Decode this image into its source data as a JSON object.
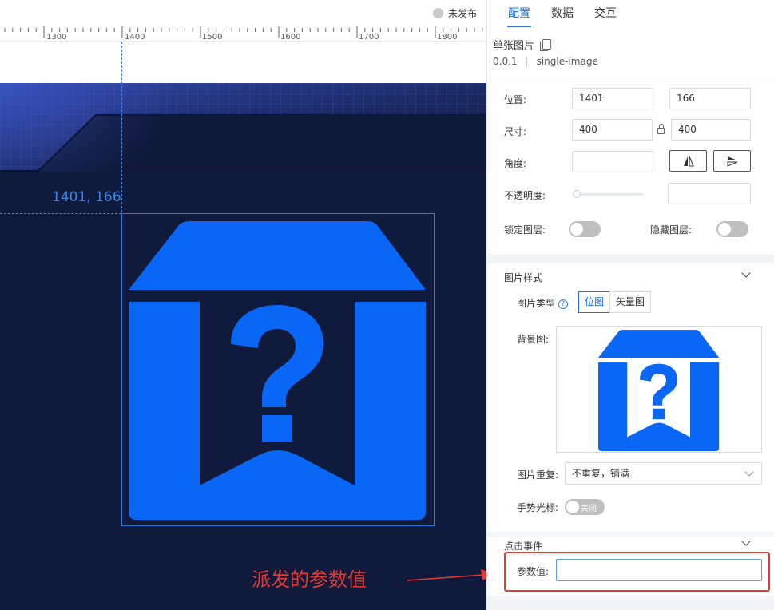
{
  "canvas": {
    "publish_status": "未发布",
    "ruler_labels": [
      "1300",
      "1400",
      "1500",
      "1600",
      "1700",
      "1800"
    ],
    "position_readout": "1401, 166",
    "annotation": "派发的参数值"
  },
  "panel": {
    "tabs": [
      "配置",
      "数据",
      "交互"
    ],
    "active_tab": "配置",
    "component_name": "单张图片",
    "version": "0.0.1",
    "component_id": "single-image",
    "labels": {
      "position": "位置:",
      "size": "尺寸:",
      "angle": "角度:",
      "opacity": "不透明度:",
      "lock_layer": "锁定图层:",
      "hide_layer": "隐藏图层:"
    },
    "values": {
      "pos_x": "1401",
      "pos_y": "166",
      "width": "400",
      "height": "400",
      "angle": "",
      "opacity": ""
    },
    "image_style": {
      "title": "图片样式",
      "type_label": "图片类型",
      "type_options": [
        "位图",
        "矢量图"
      ],
      "type_selected": "位图",
      "bg_label": "背景图:",
      "repeat_label": "图片重复:",
      "repeat_value": "不重复，铺满",
      "cursor_label": "手势光标:",
      "cursor_toggle": "关闭"
    },
    "click_event": {
      "title": "点击事件",
      "param_label": "参数值:",
      "param_value": ""
    }
  },
  "colors": {
    "accent": "#1f6fe0",
    "icon_blue": "#0a66f5",
    "stage_bg": "#0f1838",
    "annotation_red": "#e23b32"
  }
}
